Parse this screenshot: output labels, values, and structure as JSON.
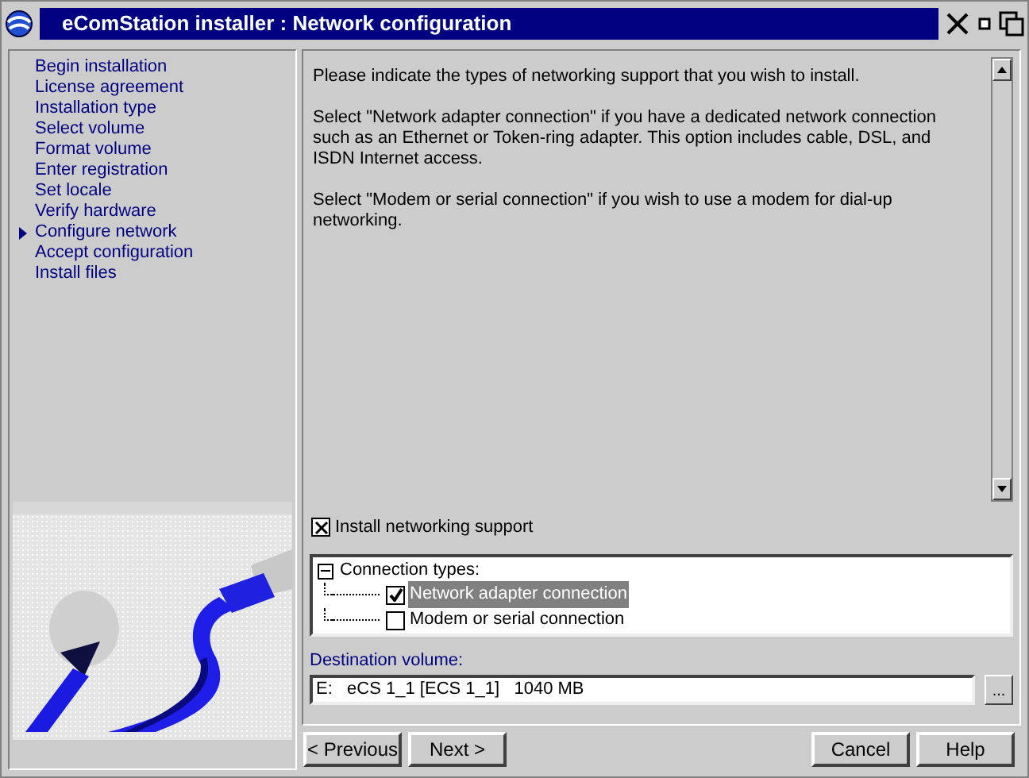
{
  "window": {
    "title": "eComStation installer : Network configuration"
  },
  "steps": [
    {
      "label": "Begin installation",
      "selected": false
    },
    {
      "label": "License agreement",
      "selected": false
    },
    {
      "label": "Installation type",
      "selected": false
    },
    {
      "label": "Select volume",
      "selected": false
    },
    {
      "label": "Format volume",
      "selected": false
    },
    {
      "label": "Enter registration",
      "selected": false
    },
    {
      "label": "Set locale",
      "selected": false
    },
    {
      "label": "Verify hardware",
      "selected": false
    },
    {
      "label": "Configure network",
      "selected": true
    },
    {
      "label": "Accept configuration",
      "selected": false
    },
    {
      "label": "Install files",
      "selected": false
    }
  ],
  "description": [
    "Please indicate the types of networking support that you wish to install.",
    "Select \"Network adapter connection\" if you have a dedicated network connection such as an Ethernet or Token-ring adapter. This option includes cable, DSL, and ISDN Internet access.",
    "Select \"Modem or serial connection\" if you wish to use a modem for dial-up networking."
  ],
  "install_networking": {
    "label": "Install networking support",
    "checked": true
  },
  "connection_tree": {
    "label": "Connection types:",
    "expanded": true,
    "children": [
      {
        "label": "Network adapter connection",
        "checked": true,
        "selected": true
      },
      {
        "label": "Modem or serial connection",
        "checked": false,
        "selected": false
      }
    ]
  },
  "destination": {
    "label": "Destination volume:",
    "value": "E:   eCS 1_1 [ECS 1_1]   1040 MB",
    "browse": "..."
  },
  "buttons": [
    {
      "label": "< Previous"
    },
    {
      "label": "Next >"
    },
    {
      "label": "Cancel"
    },
    {
      "label": "Help"
    }
  ]
}
